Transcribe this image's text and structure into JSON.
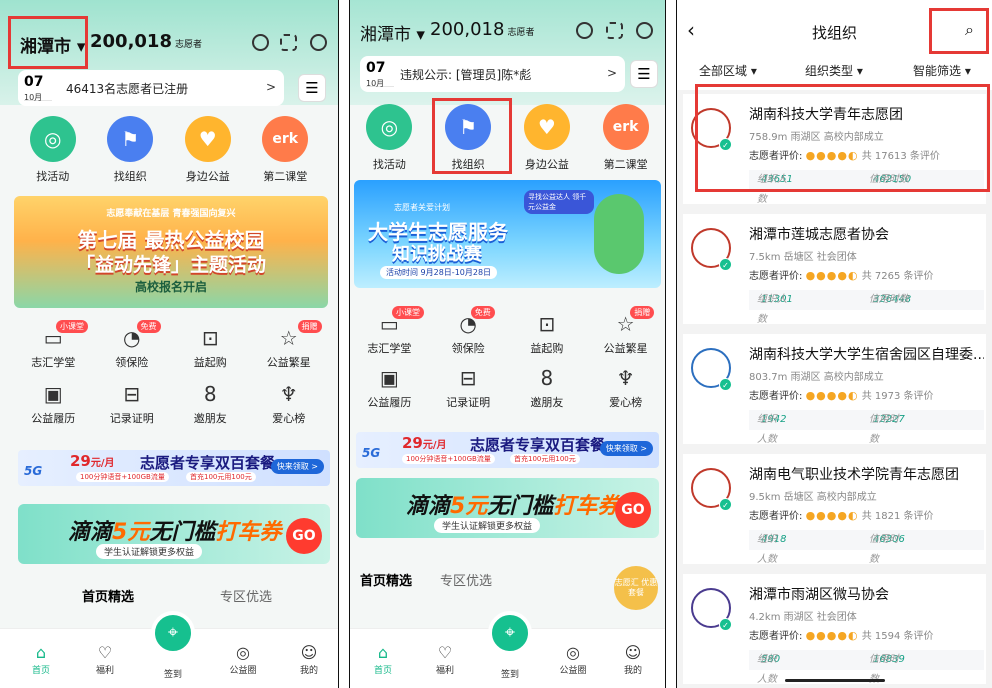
{
  "p1": {
    "city": "湘潭市",
    "count": "200,018",
    "count_unit": "志愿者",
    "date_day": "07",
    "date_month": "10月",
    "notice": "46413名志愿者已注册",
    "menu": [
      "找活动",
      "找组织",
      "身边公益",
      "第二课堂"
    ],
    "banner_lines": [
      "志愿奉献在基层 青春强国向复兴",
      "第七届 最热公益校园",
      "「益动先锋」主题活动",
      "高校报名开启"
    ],
    "grid": [
      "志汇学堂",
      "领保险",
      "益起购",
      "公益繁星",
      "公益履历",
      "记录证明",
      "邀朋友",
      "爱心榜"
    ],
    "badges": [
      "小课堂",
      "免费",
      "捐赠"
    ],
    "tabs": [
      "首页精选",
      "专区优选"
    ],
    "nav": [
      "首页",
      "福利",
      "签到",
      "公益圈",
      "我的"
    ]
  },
  "p2": {
    "city": "湘潭市",
    "count": "200,018",
    "count_unit": "志愿者",
    "date_day": "07",
    "date_month": "10月",
    "notice": "违规公示: [管理员]陈*彪",
    "menu": [
      "找活动",
      "找组织",
      "身边公益",
      "第二课堂"
    ],
    "banner_lines": [
      "志愿者关爱计划",
      "寻找公益达人 领千元公益金",
      "大学生志愿服务",
      "知识挑战赛",
      "活动时间 9月28日-10月28日"
    ],
    "grid": [
      "志汇学堂",
      "领保险",
      "益起购",
      "公益繁星",
      "公益履历",
      "记录证明",
      "邀朋友",
      "爱心榜"
    ],
    "badges": [
      "小课堂",
      "免费",
      "捐赠"
    ],
    "tabs": [
      "首页精选",
      "专区优选"
    ],
    "float_badge": "志愿汇 优惠套餐",
    "nav": [
      "首页",
      "福利",
      "签到",
      "公益圈",
      "我的"
    ]
  },
  "ad5g": {
    "brand": "5G",
    "price": "29",
    "unit": "元/月",
    "title": "志愿者专享双百套餐",
    "sub1": "100分钟语音+100GB流量",
    "sub2": "首充100元用100元",
    "btn": "快来领取 >"
  },
  "didi": {
    "title_a": "滴滴",
    "title_b": "5元",
    "title_c": "无门槛",
    "title_d": "打车券",
    "sub": "学生认证解锁更多权益",
    "go": "GO"
  },
  "p3": {
    "title": "找组织",
    "filters": [
      "全部区域 ▾",
      "组织类型 ▾",
      "智能筛选 ▾"
    ],
    "rate_label": "志愿者评价:",
    "members_label": "组织人数",
    "hours_label": "信用时数",
    "orgs": [
      {
        "name": "湖南科技大学青年志愿团",
        "meta": "758.9m 雨湖区 高校内部成立",
        "total": "共 17613 条评价",
        "members": "43651",
        "hours": "462150"
      },
      {
        "name": "湘潭市莲城志愿者协会",
        "meta": "7.5km 岳塘区 社会团体",
        "total": "共 7265 条评价",
        "members": "11301",
        "hours": "326448"
      },
      {
        "name": "湖南科技大学大学生宿舍园区自理委...",
        "meta": "803.7m 雨湖区 高校内部成立",
        "total": "共 1973 条评价",
        "members": "1942",
        "hours": "12227"
      },
      {
        "name": "湖南电气职业技术学院青年志愿团",
        "meta": "9.5km 岳塘区 高校内部成立",
        "total": "共 1821 条评价",
        "members": "4918",
        "hours": "46306"
      },
      {
        "name": "湘潭市雨湖区微马协会",
        "meta": "4.2km 雨湖区 社会团体",
        "total": "共 1594 条评价",
        "members": "580",
        "hours": "16839"
      }
    ]
  }
}
